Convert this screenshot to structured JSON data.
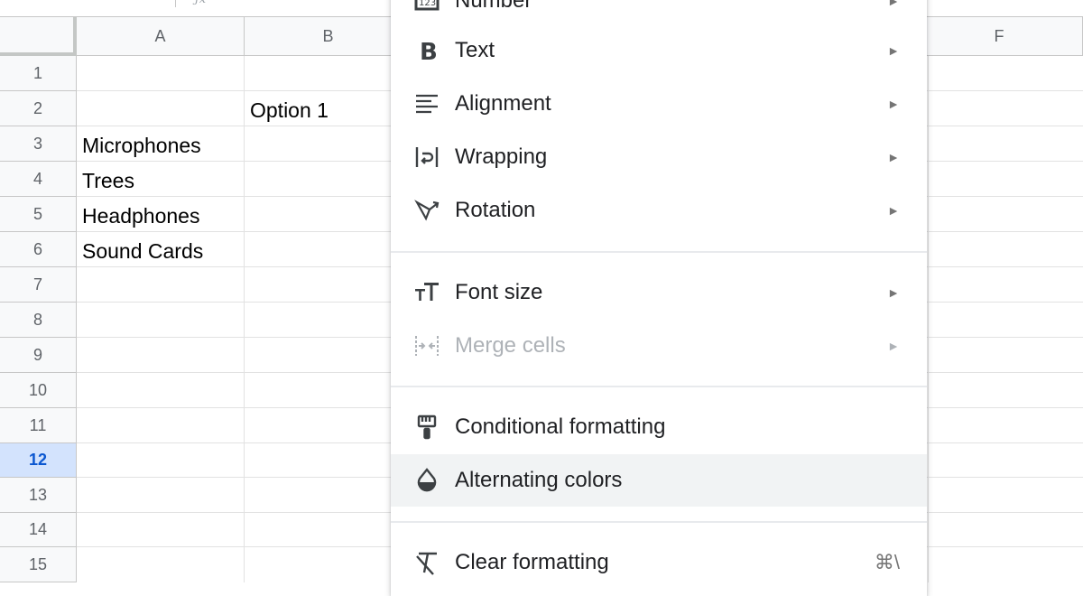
{
  "sheet": {
    "columns": [
      "A",
      "B",
      "F"
    ],
    "rows": [
      "1",
      "2",
      "3",
      "4",
      "5",
      "6",
      "7",
      "8",
      "9",
      "10",
      "11",
      "12",
      "13",
      "14",
      "15"
    ],
    "selected_row": "12",
    "cells": {
      "B2": "Option 1",
      "A3": "Microphones",
      "A4": "Trees",
      "A5": "Headphones",
      "A6": "Sound Cards"
    }
  },
  "menu": {
    "items": [
      {
        "label": "Number",
        "icon": "number-format-icon",
        "submenu": true
      },
      {
        "label": "Text",
        "icon": "bold-icon",
        "submenu": true
      },
      {
        "label": "Alignment",
        "icon": "align-left-icon",
        "submenu": true
      },
      {
        "label": "Wrapping",
        "icon": "wrap-text-icon",
        "submenu": true
      },
      {
        "label": "Rotation",
        "icon": "text-rotation-icon",
        "submenu": true
      },
      {
        "label": "Font size",
        "icon": "font-size-icon",
        "submenu": true
      },
      {
        "label": "Merge cells",
        "icon": "merge-cells-icon",
        "submenu": true,
        "disabled": true
      },
      {
        "label": "Conditional formatting",
        "icon": "paint-roller-icon"
      },
      {
        "label": "Alternating colors",
        "icon": "color-drop-icon",
        "hover": true
      },
      {
        "label": "Clear formatting",
        "icon": "clear-format-icon",
        "shortcut": "⌘\\"
      }
    ],
    "submenu_arrow": "►"
  },
  "colors": {
    "selected_row_bg": "#d3e3fd",
    "selected_row_text": "#0b57d0",
    "menu_hover": "#f1f3f4"
  }
}
